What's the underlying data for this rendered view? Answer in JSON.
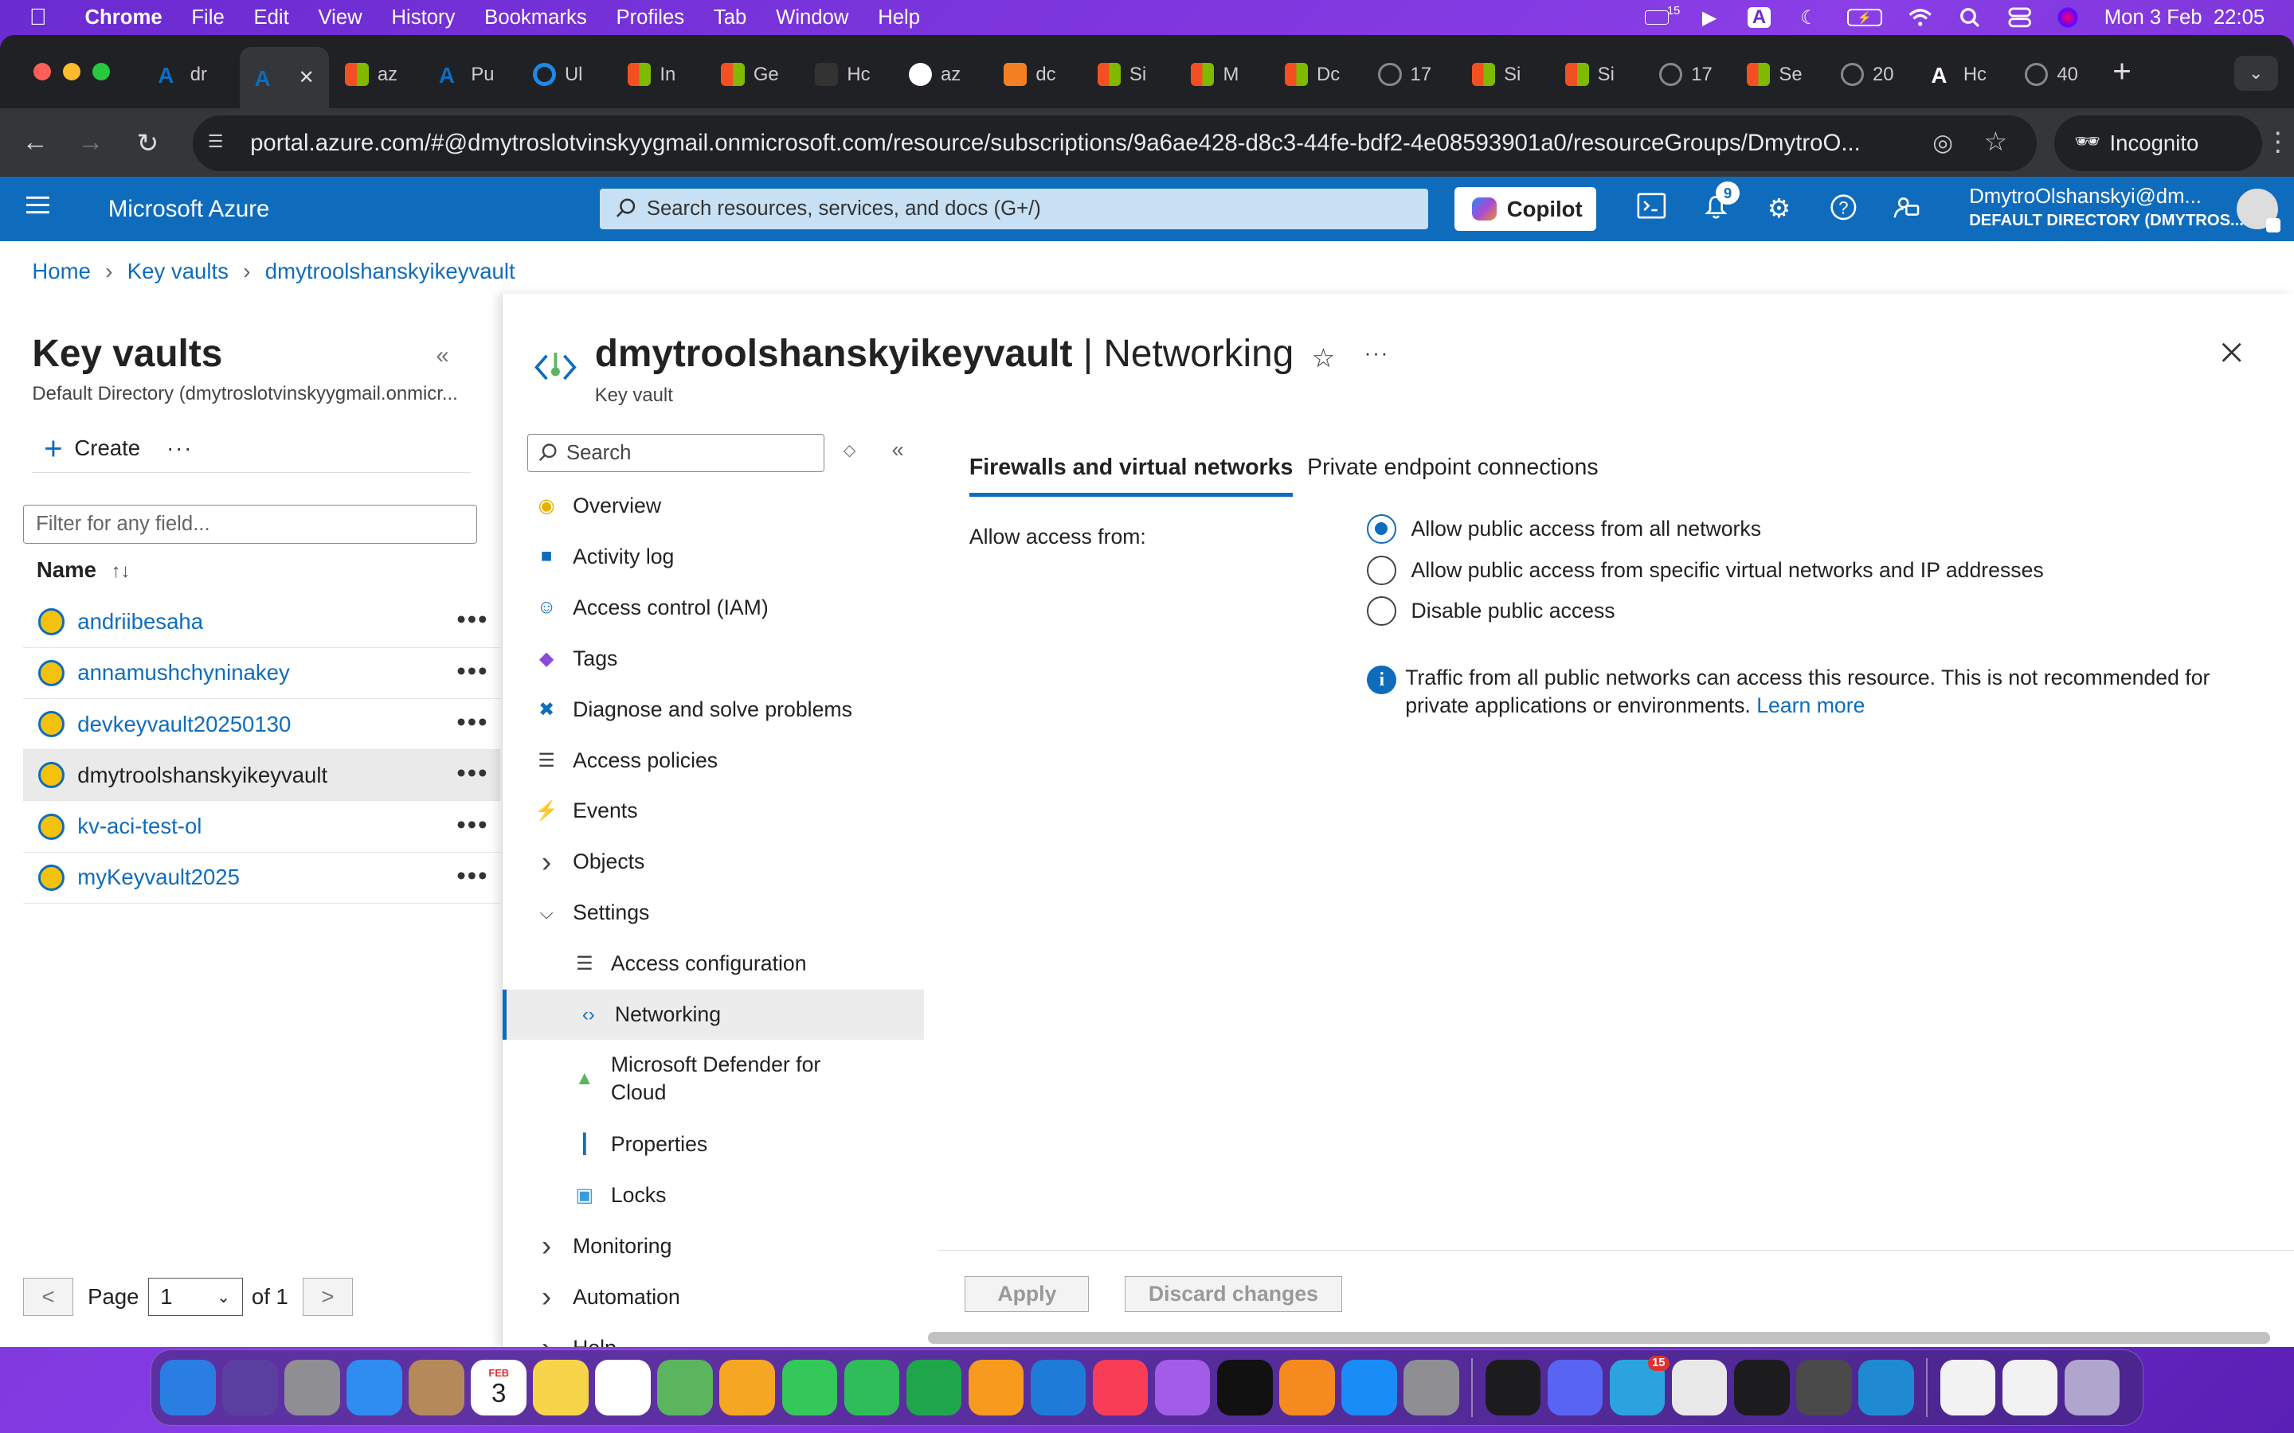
{
  "menubar": {
    "app": "Chrome",
    "items": [
      "File",
      "Edit",
      "View",
      "History",
      "Bookmarks",
      "Profiles",
      "Tab",
      "Window",
      "Help"
    ],
    "clock": "Mon 3 Feb  22:05",
    "badge_count": "15"
  },
  "browser": {
    "tabs": [
      {
        "label": "dr",
        "favicon": "azure-icon",
        "color": "#0f6cbd"
      },
      {
        "label": "",
        "favicon": "azure-icon",
        "color": "#0f6cbd",
        "active": true
      },
      {
        "label": "az",
        "favicon": "microsoft-icon",
        "color": "#f25022"
      },
      {
        "label": "Pu",
        "favicon": "azure-icon",
        "color": "#0f6cbd"
      },
      {
        "label": "Ul",
        "favicon": "ring-icon",
        "color": "#1e88e5"
      },
      {
        "label": "In",
        "favicon": "microsoft-icon",
        "color": "#f25022"
      },
      {
        "label": "Ge",
        "favicon": "microsoft-icon",
        "color": "#f25022"
      },
      {
        "label": "Hc",
        "favicon": "octopus-icon",
        "color": "#333"
      },
      {
        "label": "az",
        "favicon": "google-icon",
        "color": "#fff"
      },
      {
        "label": "dc",
        "favicon": "stack-icon",
        "color": "#f48024"
      },
      {
        "label": "Si",
        "favicon": "microsoft-icon",
        "color": "#f25022"
      },
      {
        "label": "M",
        "favicon": "microsoft-icon",
        "color": "#f25022"
      },
      {
        "label": "Dc",
        "favicon": "microsoft-icon",
        "color": "#f25022"
      },
      {
        "label": "17",
        "favicon": "globe-icon",
        "color": "#888"
      },
      {
        "label": "Si",
        "favicon": "microsoft-icon",
        "color": "#f25022"
      },
      {
        "label": "Si",
        "favicon": "microsoft-icon",
        "color": "#f25022"
      },
      {
        "label": "17",
        "favicon": "globe-icon",
        "color": "#888"
      },
      {
        "label": "Se",
        "favicon": "microsoft-icon",
        "color": "#f25022"
      },
      {
        "label": "20",
        "favicon": "globe-icon",
        "color": "#888"
      },
      {
        "label": "Hc",
        "favicon": "azure-icon",
        "color": "#fff"
      },
      {
        "label": "40",
        "favicon": "globe-icon",
        "color": "#888"
      }
    ],
    "url": "portal.azure.com/#@dmytroslotvinskyygmail.onmicrosoft.com/resource/subscriptions/9a6ae428-d8c3-44fe-bdf2-4e08593901a0/resourceGroups/DmytroO...",
    "incognito_label": "Incognito"
  },
  "azure": {
    "brand": "Microsoft Azure",
    "search_placeholder": "Search resources, services, and docs (G+/)",
    "copilot_label": "Copilot",
    "notification_count": "9",
    "account_name": "DmytroOlshanskyi@dm...",
    "account_directory": "DEFAULT DIRECTORY (DMYTROS..."
  },
  "breadcrumb": [
    "Home",
    "Key vaults",
    "dmytroolshanskyikeyvault"
  ],
  "left_blade": {
    "title": "Key vaults",
    "directory": "Default Directory (dmytroslotvinskyygmail.onmicr...",
    "create_label": "Create",
    "filter_placeholder": "Filter for any field...",
    "column_name": "Name",
    "vaults": [
      "andriibesaha",
      "annamushchyninakey",
      "devkeyvault20250130",
      "dmytroolshanskyikeyvault",
      "kv-aci-test-ol",
      "myKeyvault2025"
    ],
    "selected_index": 3,
    "pager": {
      "prev": "<",
      "page_label": "Page",
      "page_value": "1",
      "of_label": "of 1",
      "next": ">"
    }
  },
  "resource": {
    "name": "dmytroolshanskyikeyvault",
    "section": "Networking",
    "type": "Key vault",
    "menu_search_placeholder": "Search",
    "menu": [
      {
        "label": "Overview",
        "icon": "key-icon",
        "kind": "item"
      },
      {
        "label": "Activity log",
        "icon": "log-icon",
        "kind": "item"
      },
      {
        "label": "Access control (IAM)",
        "icon": "people-icon",
        "kind": "item"
      },
      {
        "label": "Tags",
        "icon": "tag-icon",
        "kind": "item"
      },
      {
        "label": "Diagnose and solve problems",
        "icon": "wrench-icon",
        "kind": "item"
      },
      {
        "label": "Access policies",
        "icon": "list-icon",
        "kind": "item"
      },
      {
        "label": "Events",
        "icon": "bolt-icon",
        "kind": "item"
      },
      {
        "label": "Objects",
        "icon": "chevron-right-icon",
        "kind": "group"
      },
      {
        "label": "Settings",
        "icon": "chevron-down-icon",
        "kind": "group"
      },
      {
        "label": "Access configuration",
        "icon": "checklist-icon",
        "kind": "sub"
      },
      {
        "label": "Networking",
        "icon": "network-icon",
        "kind": "sub",
        "active": true
      },
      {
        "label": "Microsoft Defender for Cloud",
        "icon": "shield-icon",
        "kind": "sub"
      },
      {
        "label": "Properties",
        "icon": "properties-icon",
        "kind": "sub"
      },
      {
        "label": "Locks",
        "icon": "lock-icon",
        "kind": "sub"
      },
      {
        "label": "Monitoring",
        "icon": "chevron-right-icon",
        "kind": "group"
      },
      {
        "label": "Automation",
        "icon": "chevron-right-icon",
        "kind": "group"
      },
      {
        "label": "Help",
        "icon": "chevron-right-icon",
        "kind": "group"
      }
    ],
    "tabs": [
      "Firewalls and virtual networks",
      "Private endpoint connections"
    ],
    "allow_label": "Allow access from:",
    "options": [
      {
        "label": "Allow public access from all networks",
        "checked": true
      },
      {
        "label": "Allow public access from specific virtual networks and IP addresses",
        "checked": false
      },
      {
        "label": "Disable public access",
        "checked": false
      }
    ],
    "info_text": "Traffic from all public networks can access this resource. This is not recommended for private applications or environments.",
    "info_link": "Learn more",
    "apply_label": "Apply",
    "discard_label": "Discard changes"
  },
  "dock": [
    {
      "name": "finder-icon",
      "color": "#2a7de1"
    },
    {
      "name": "siri-icon",
      "color": "#5b3fa0"
    },
    {
      "name": "launchpad-icon",
      "color": "#8e8e93"
    },
    {
      "name": "mail-icon",
      "color": "#2f8cf0"
    },
    {
      "name": "contacts-icon",
      "color": "#b48a5a"
    },
    {
      "name": "calendar-icon",
      "color": "#ffffff"
    },
    {
      "name": "notes-icon",
      "color": "#f7d54a"
    },
    {
      "name": "reminders-icon",
      "color": "#ffffff"
    },
    {
      "name": "maps-icon",
      "color": "#5ab55e"
    },
    {
      "name": "photos-icon",
      "color": "#f5a623"
    },
    {
      "name": "messages-icon",
      "color": "#34c759"
    },
    {
      "name": "facetime-icon",
      "color": "#2ebd59"
    },
    {
      "name": "numbers-icon",
      "color": "#1fa64a"
    },
    {
      "name": "pages-icon",
      "color": "#f79a1e"
    },
    {
      "name": "keynote-icon",
      "color": "#1f7bd8"
    },
    {
      "name": "music-icon",
      "color": "#fa3d56"
    },
    {
      "name": "podcasts-icon",
      "color": "#a25ce8"
    },
    {
      "name": "appletv-icon",
      "color": "#111111"
    },
    {
      "name": "books-icon",
      "color": "#f58a1f"
    },
    {
      "name": "appstore-icon",
      "color": "#1a8cf5"
    },
    {
      "name": "settings-icon",
      "color": "#8e8e93"
    },
    {
      "name": "activity-monitor-icon",
      "color": "#1c1c1e"
    },
    {
      "name": "discord-icon",
      "color": "#5865f2"
    },
    {
      "name": "telegram-icon",
      "color": "#2aa3df",
      "badge": "15"
    },
    {
      "name": "chrome-icon",
      "color": "#e8e8e8"
    },
    {
      "name": "terminal-icon",
      "color": "#1c1c1e"
    },
    {
      "name": "sublime-icon",
      "color": "#4a4a4a"
    },
    {
      "name": "vscode-icon",
      "color": "#1f8ad2"
    }
  ],
  "calendar_day": "3",
  "calendar_month": "FEB"
}
